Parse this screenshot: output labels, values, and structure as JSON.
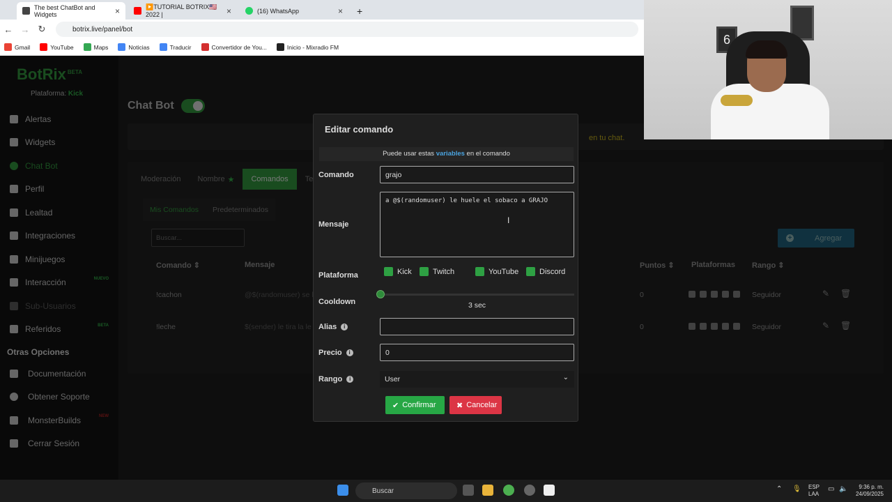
{
  "browser": {
    "tabs": [
      {
        "label": "The best ChatBot and Widgets",
        "color": "#444444",
        "active": true
      },
      {
        "label": "▶️TUTORIAL BOTRIX🇺🇸 2022 | ",
        "color": "#ff0000",
        "active": false
      },
      {
        "label": "(16) WhatsApp",
        "color": "#25d366",
        "active": false
      }
    ],
    "url": "botrix.live/panel/bot",
    "bookmarks": [
      "Gmail",
      "YouTube",
      "Maps",
      "Noticias",
      "Traducir",
      "Convertidor de You...",
      "Inicio - Mixradio FM"
    ]
  },
  "sidebar": {
    "logo": "BotRix",
    "logo_badge": "BETA",
    "platform_label": "Plataforma:",
    "platform_value": "Kick",
    "items": [
      {
        "label": "Alertas",
        "tag": ""
      },
      {
        "label": "Widgets",
        "tag": ""
      },
      {
        "label": "Chat Bot",
        "tag": ""
      },
      {
        "label": "Perfil",
        "tag": ""
      },
      {
        "label": "Lealtad",
        "tag": ""
      },
      {
        "label": "Integraciones",
        "tag": ""
      },
      {
        "label": "Minijuegos",
        "tag": ""
      },
      {
        "label": "Interacción",
        "tag": "NUEVO"
      },
      {
        "label": "Sub-Usuarios",
        "tag": ""
      },
      {
        "label": "Referidos",
        "tag": "BETA"
      }
    ],
    "section_title": "Otras Opciones",
    "other_items": [
      {
        "label": "Documentación",
        "tag": ""
      },
      {
        "label": "Obtener Soporte",
        "tag": ""
      },
      {
        "label": "MonsterBuilds",
        "tag": "NEW"
      },
      {
        "label": "Cerrar Sesión",
        "tag": ""
      }
    ]
  },
  "main": {
    "title": "Chat Bot",
    "banner_text": "en tu chat.",
    "tabs": [
      "Moderación",
      "Nombre",
      "Comandos",
      "Te"
    ],
    "subtabs": [
      "Mis Comandos",
      "Predeterminados"
    ],
    "search_placeholder": "Buscar...",
    "add_label": "Agregar",
    "columns": [
      "Comando",
      "Mensaje",
      "Puntos",
      "Plataformas",
      "Rango"
    ],
    "rows": [
      {
        "command": "!cachon",
        "message": "@$(randomuser) se l",
        "points": "0",
        "rank": "Seguidor"
      },
      {
        "command": "!leche",
        "message": "$(sender) le tira la le",
        "points": "0",
        "rank": "Seguidor"
      }
    ]
  },
  "modal": {
    "title": "Editar comando",
    "hint_pre": "Puede usar estas",
    "hint_link": "variables",
    "hint_post": "en el comando",
    "command_label": "Comando",
    "command_value": "grajo",
    "message_label": "Mensaje",
    "message_value": "a @$(randomuser) le huele el sobaco a GRAJO",
    "platform_label": "Plataforma",
    "platforms": [
      "Kick",
      "Twitch",
      "YouTube",
      "Discord"
    ],
    "cooldown_label": "Cooldown",
    "cooldown_value": "3 sec",
    "cooldown_fraction": 0,
    "alias_label": "Alias",
    "alias_value": "",
    "price_label": "Precio",
    "price_value": "0",
    "rank_label": "Rango",
    "rank_value": "User",
    "confirm_label": "Confirmar",
    "cancel_label": "Cancelar"
  },
  "taskbar": {
    "search_label": "Buscar",
    "lang": "ESP",
    "layout": "LAA",
    "time": "9:36 p. m.",
    "date": "24/09/2025"
  },
  "colors": {
    "accent": "#2e8b3a",
    "confirm": "#27a745",
    "cancel": "#dc3545",
    "link": "#4aa3df"
  }
}
